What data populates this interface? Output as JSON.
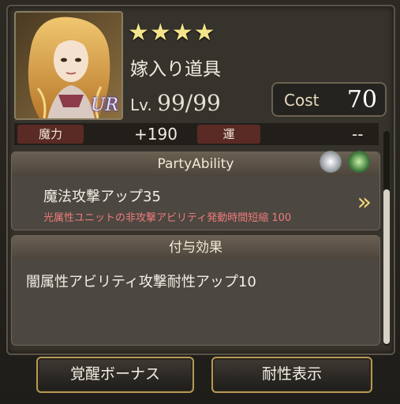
{
  "item": {
    "stars": "★★★★",
    "name": "嫁入り道具",
    "rarity_badge": "UR",
    "level_label": "Lv.",
    "level": "99/99",
    "cost_label": "Cost",
    "cost_value": "70"
  },
  "stats": {
    "magic_label": "魔力",
    "magic_value": "+190",
    "luck_label": "運",
    "luck_value": "--"
  },
  "party_ability": {
    "title": "PartyAbility",
    "effect": "魔法攻撃アップ35",
    "condition": "光属性ユニットの非攻撃アビリティ発動時間短縮 100",
    "icons": [
      "magic-orb-icon",
      "mountain-up-icon"
    ]
  },
  "grant_effect": {
    "title": "付与効果",
    "effect": "闇属性アビリティ攻撃耐性アップ10"
  },
  "buttons": {
    "awaken_bonus": "覚醒ボーナス",
    "resistance": "耐性表示"
  },
  "colors": {
    "accent_gold": "#b59a56",
    "star": "#f3e48b",
    "condition_text": "#ef7b7b",
    "stat_tag": "#5a2a24"
  }
}
